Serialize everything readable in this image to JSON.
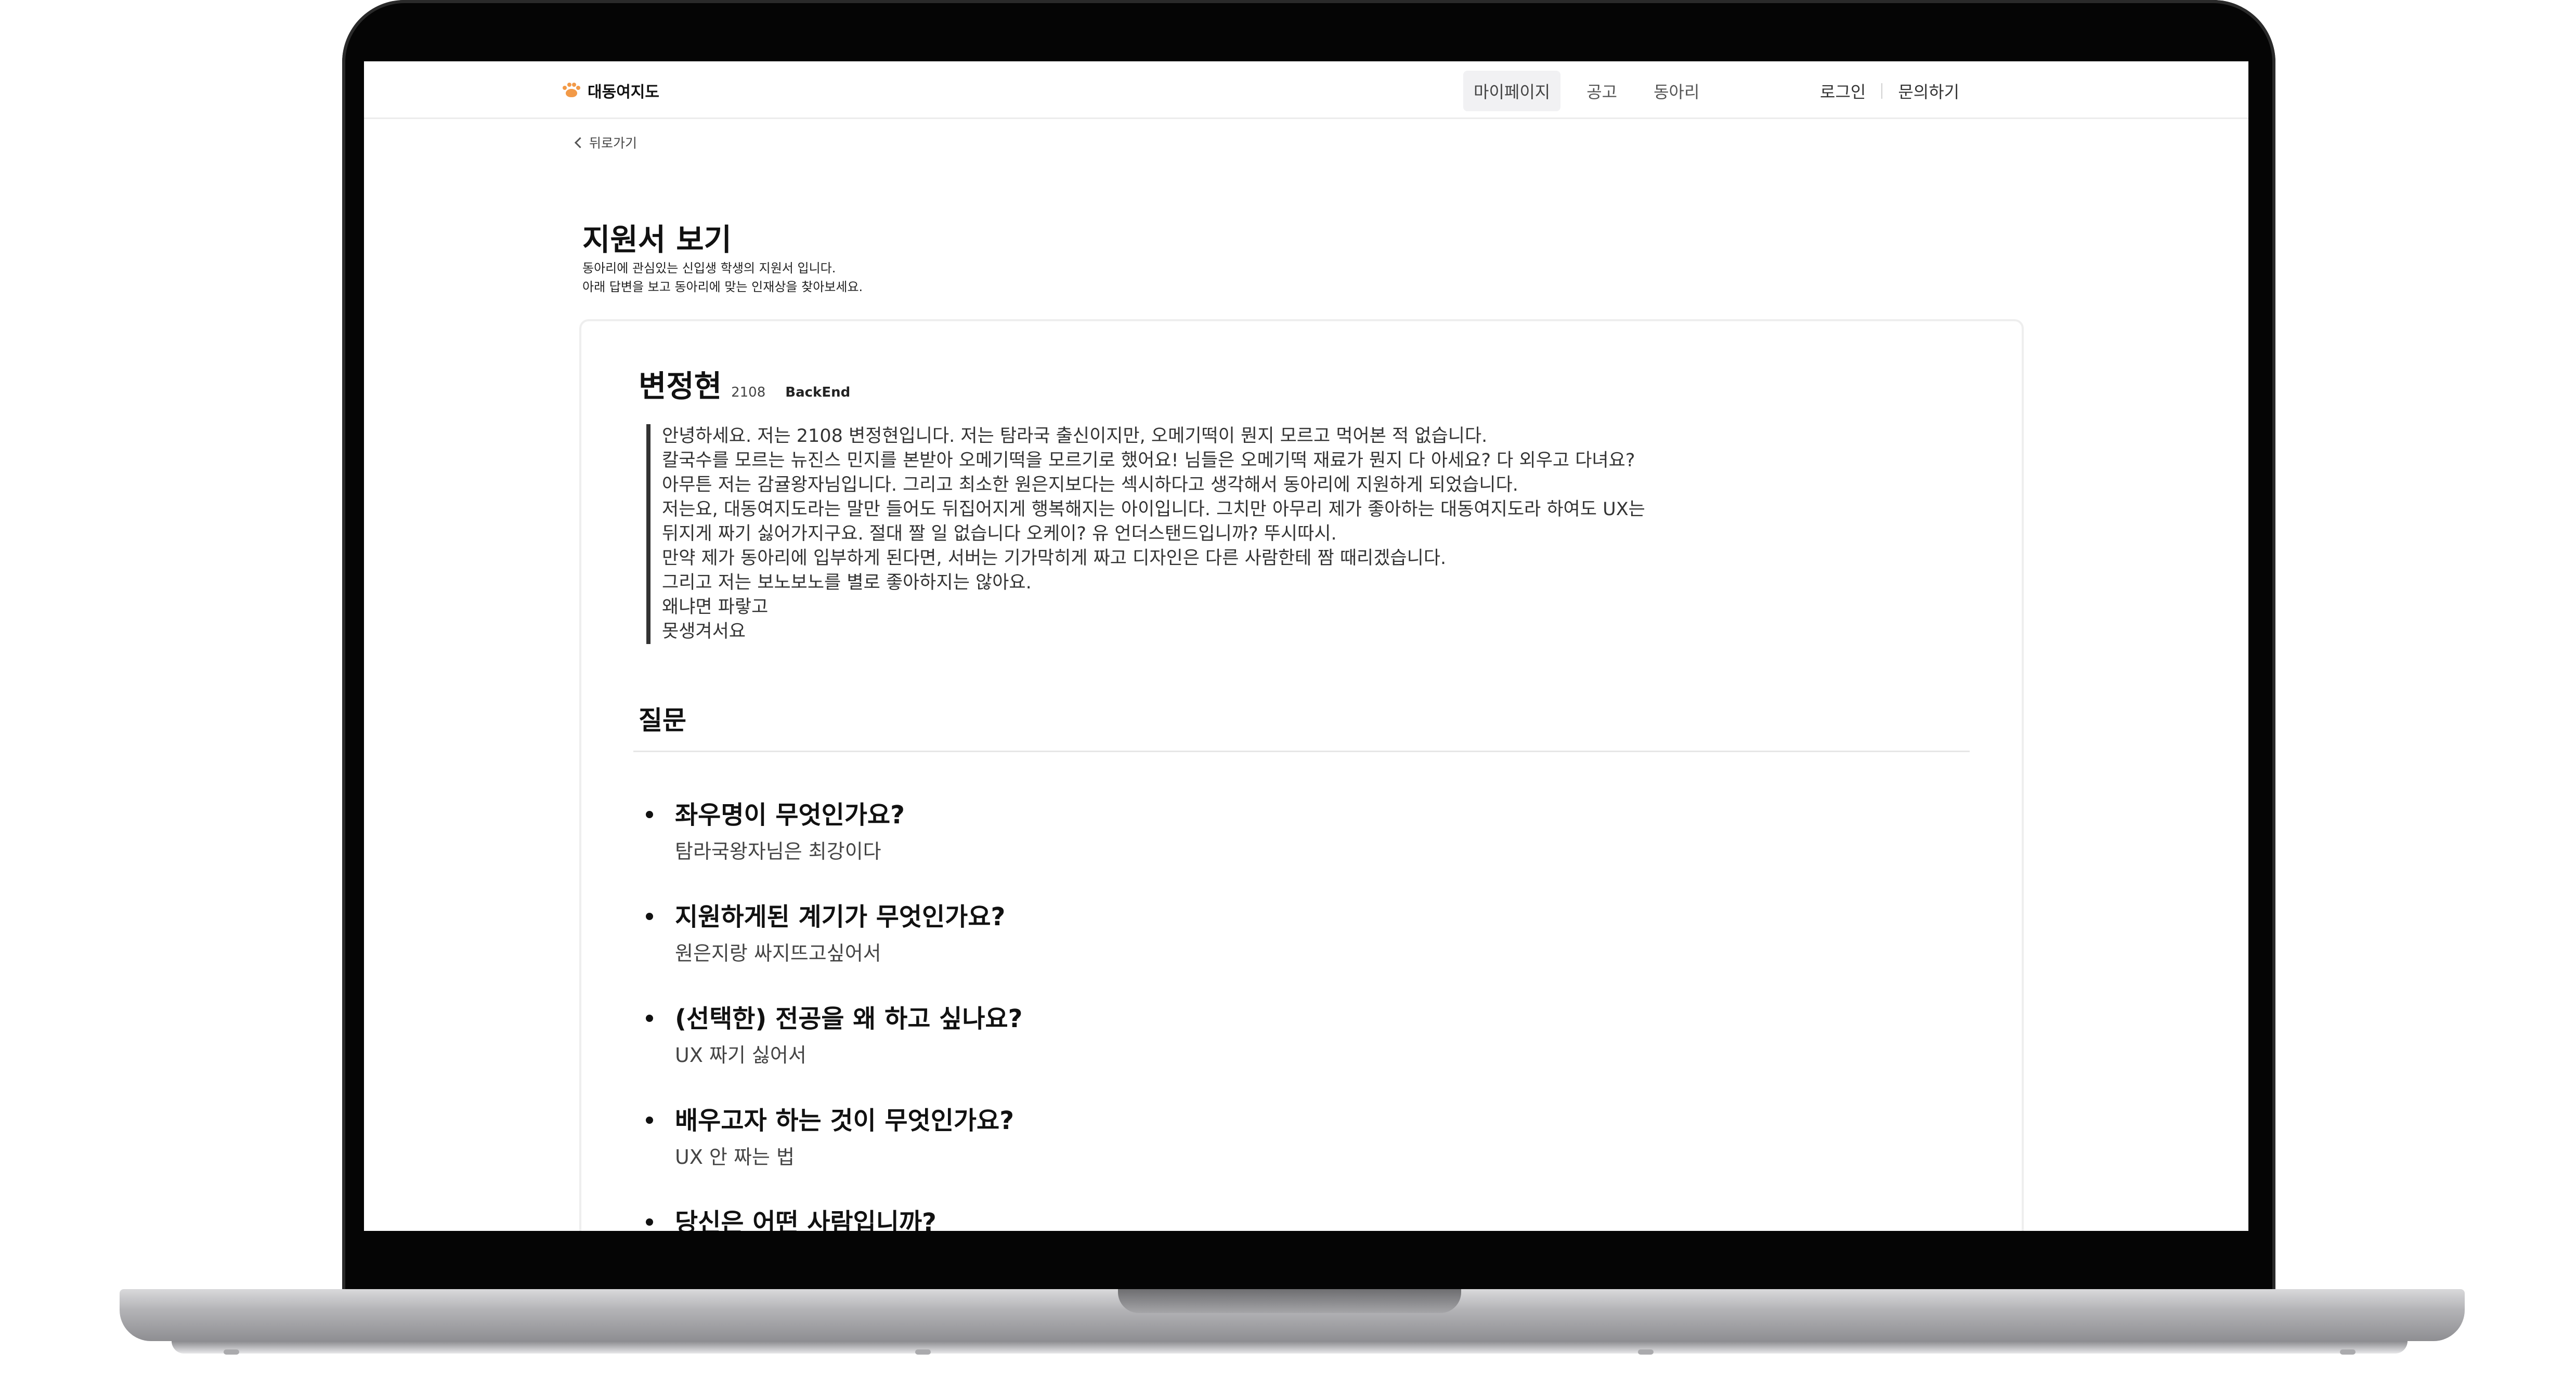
{
  "header": {
    "logo_text": "대동여지도",
    "nav": [
      "마이페이지",
      "공고",
      "동아리"
    ],
    "auth": {
      "login": "로그인",
      "contact": "문의하기"
    }
  },
  "back_label": "뒤로가기",
  "page": {
    "title": "지원서 보기",
    "desc_line1": "동아리에 관심있는 신입생 학생의 지원서 입니다.",
    "desc_line2": "아래 답변을 보고 동아리에 맞는 인재상을 찾아보세요."
  },
  "applicant": {
    "name": "변정현",
    "id": "2108",
    "track": "BackEnd"
  },
  "intro_lines": [
    "안녕하세요. 저는 2108 변정현입니다. 저는 탐라국 출신이지만, 오메기떡이 뭔지 모르고 먹어본 적 없습니다.",
    "칼국수를 모르는 뉴진스 민지를 본받아 오메기떡을 모르기로 했어요! 님들은 오메기떡 재료가 뭔지 다 아세요? 다 외우고 다녀요?",
    "아무튼 저는 감귤왕자님입니다. 그리고 최소한 원은지보다는 섹시하다고 생각해서 동아리에 지원하게 되었습니다.",
    "저는요, 대동여지도라는 말만 들어도 뒤집어지게 행복해지는 아이입니다. 그치만 아무리 제가 좋아하는 대동여지도라 하여도 UX는",
    "뒤지게 짜기 싫어가지구요. 절대 짤 일 없습니다 오케이? 유 언더스탠드입니까? 뚜시따시.",
    "만약 제가 동아리에 입부하게 된다면, 서버는 기가막히게 짜고 디자인은 다른 사람한테 짬 때리겠습니다.",
    "그리고 저는 보노보노를 별로 좋아하지는 않아요.",
    "왜냐면 파랗고",
    "못생겨서요"
  ],
  "section_title": "질문",
  "qa": [
    {
      "question": "좌우명이 무엇인가요?",
      "answer": "탐라국왕자님은 최강이다"
    },
    {
      "question": "지원하게된 계기가 무엇인가요?",
      "answer": "원은지랑 싸지뜨고싶어서"
    },
    {
      "question": "(선택한) 전공을 왜 하고 싶나요?",
      "answer": "UX 짜기 싫어서"
    },
    {
      "question": "배우고자 하는 것이 무엇인가요?",
      "answer": "UX 안 짜는 법"
    },
    {
      "question": "당신은 어떤 사람입니까?",
      "answer": ""
    }
  ],
  "colors": {
    "logo_accent": "#f29a48",
    "nav_active_bg": "#f1f1f3",
    "quote_bar": "#333333"
  },
  "icons": {
    "logo": "paw-icon",
    "back": "chevron-left-icon"
  }
}
